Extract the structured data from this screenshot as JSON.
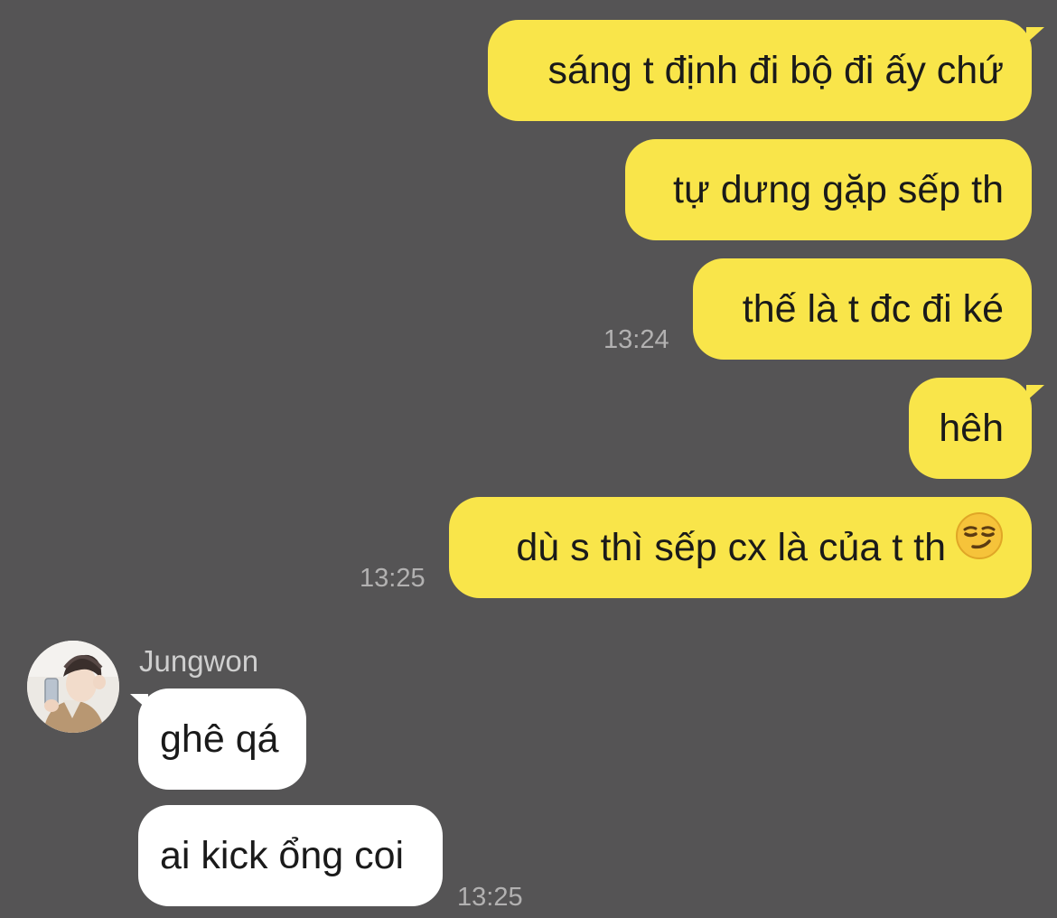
{
  "contact": {
    "name": "Jungwon",
    "avatar_icon": "avatar-photo"
  },
  "messages_out": [
    {
      "text": "sáng t định đi bộ đi ấy chứ"
    },
    {
      "text": "tự dưng gặp sếp th"
    },
    {
      "text": "thế là t đc đi ké",
      "time": "13:24"
    },
    {
      "text": "hêh"
    },
    {
      "text": "dù s thì sếp cx là của t th",
      "emoji": "smirk-emoji",
      "time": "13:25"
    }
  ],
  "messages_in": [
    {
      "text": "ghê qá"
    },
    {
      "text": "ai kick ổng coi",
      "time": "13:25"
    }
  ],
  "colors": {
    "background": "#555455",
    "outgoing_bubble": "#f9e54a",
    "incoming_bubble": "#ffffff",
    "timestamp": "#b2b1b1"
  }
}
